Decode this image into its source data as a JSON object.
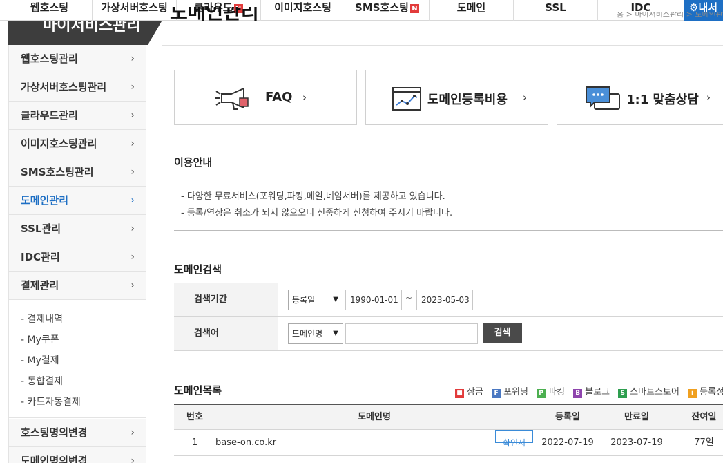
{
  "topnav": {
    "items": [
      {
        "label": "웹호스팅",
        "new": false
      },
      {
        "label": "가상서버호스팅",
        "new": false
      },
      {
        "label": "클라우드",
        "new": true
      },
      {
        "label": "이미지호스팅",
        "new": false
      },
      {
        "label": "SMS호스팅",
        "new": true
      },
      {
        "label": "도메인",
        "new": false
      },
      {
        "label": "SSL",
        "new": false
      },
      {
        "label": "IDC",
        "new": false
      }
    ],
    "new_badge": "N",
    "myaccount_label": "내서",
    "myaccount_icon": "gear-icon"
  },
  "header": {
    "sidebar_title": "마이서비스관리",
    "page_title": "도메인관리",
    "breadcrumb": "홈 > 마이서비스관리 > 도메인관리"
  },
  "sidebar": {
    "items": [
      {
        "label": "웹호스팅관리",
        "active": false
      },
      {
        "label": "가상서버호스팅관리",
        "active": false
      },
      {
        "label": "클라우드관리",
        "active": false
      },
      {
        "label": "이미지호스팅관리",
        "active": false
      },
      {
        "label": "SMS호스팅관리",
        "active": false
      },
      {
        "label": "도메인관리",
        "active": true
      },
      {
        "label": "SSL관리",
        "active": false
      },
      {
        "label": "IDC관리",
        "active": false
      },
      {
        "label": "결제관리",
        "active": false
      }
    ],
    "sub_items": [
      "- 결제내역",
      "- My쿠폰",
      "- My결제",
      "- 통합결제",
      "- 카드자동결제"
    ],
    "bottom_items": [
      "호스팅명의변경",
      "도메인명의변경"
    ]
  },
  "cards": [
    {
      "label": "FAQ",
      "icon": "megaphone-icon"
    },
    {
      "label": "도메인등록비용",
      "icon": "chart-window-icon"
    },
    {
      "label": "1:1 맞춤상담",
      "icon": "chat-bubbles-icon"
    }
  ],
  "info": {
    "title": "이용안내",
    "lines": [
      "- 다양한 무료서비스(포워딩,파킹,메일,네임서버)를 제공하고 있습니다.",
      "- 등록/연장은 취소가 되지 않으오니 신중하게 신청하여 주시기 바랍니다."
    ]
  },
  "search": {
    "title": "도메인검색",
    "period_label": "검색기간",
    "period_type": "등록일",
    "date_from": "1990-01-01",
    "tilde": "~",
    "date_to": "2023-05-03",
    "keyword_label": "검색어",
    "keyword_type": "도메인명",
    "keyword_value": "",
    "button": "검색"
  },
  "list": {
    "title": "도메인목록",
    "legend": [
      {
        "badge": "🔒",
        "label": "잠금",
        "color": "#e23b3b"
      },
      {
        "badge": "F",
        "label": "포워딩",
        "color": "#4a78c2"
      },
      {
        "badge": "P",
        "label": "파킹",
        "color": "#4caf50"
      },
      {
        "badge": "B",
        "label": "블로그",
        "color": "#8e44ad"
      },
      {
        "badge": "S",
        "label": "스마트스토어",
        "color": "#2e9e4f"
      },
      {
        "badge": "i",
        "label": "등록정보숨",
        "color": "#f0a020"
      }
    ],
    "columns": [
      "번호",
      "도메인명",
      "등록일",
      "만료일",
      "잔여일"
    ],
    "rows": [
      {
        "no": "1",
        "domain": "base-on.co.kr",
        "badge": "확인서",
        "reg": "2022-07-19",
        "exp": "2023-07-19",
        "left": "77일"
      }
    ]
  }
}
